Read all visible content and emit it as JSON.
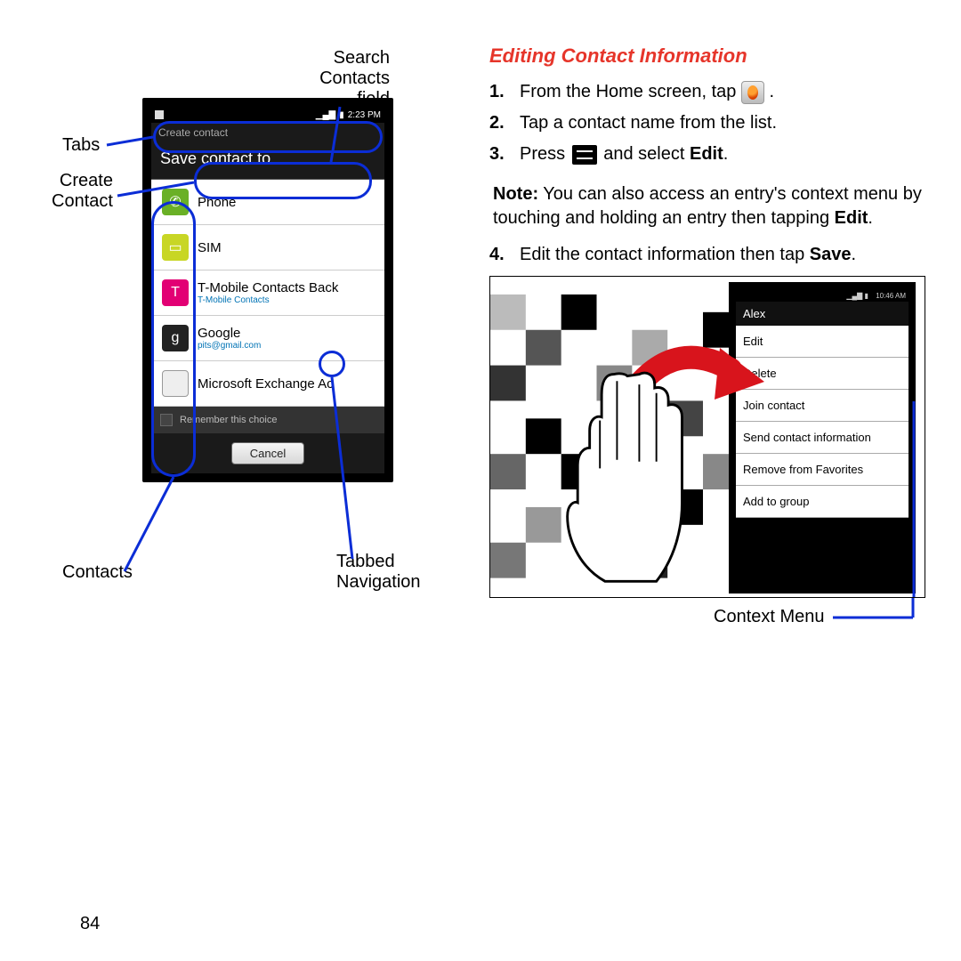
{
  "page_number": "84",
  "left_figure": {
    "callouts": {
      "search": "Search\nContacts\nfield",
      "tabs": "Tabs",
      "create": "Create\nContact",
      "contacts": "Contacts",
      "tabbed": "Tabbed\nNavigation"
    },
    "status_time": "2:23 PM",
    "create_header": "Create contact",
    "dialog_title": "Save contact to",
    "destinations": [
      {
        "title": "Phone",
        "sub": ""
      },
      {
        "title": "SIM",
        "sub": ""
      },
      {
        "title": "T-Mobile Contacts Back",
        "sub": "T-Mobile Contacts"
      },
      {
        "title": "Google",
        "sub": "pits@gmail.com"
      },
      {
        "title": "Microsoft Exchange Ac",
        "sub": ""
      }
    ],
    "remember": "Remember this choice",
    "cancel": "Cancel"
  },
  "right": {
    "title": "Editing Contact Information",
    "steps": {
      "s1a": "From the Home screen, tap ",
      "s1b": ".",
      "s2": "Tap a contact name from the list.",
      "s3a": "Press ",
      "s3b": " and select ",
      "s3c": "Edit",
      "s3d": ".",
      "note_label": "Note:",
      "note_body": " You can also access an entry's context menu by touching and holding an entry then tapping ",
      "note_bold": "Edit",
      "note_end": ".",
      "s4a": "Edit the contact information then tap ",
      "s4b": "Save",
      "s4c": "."
    },
    "fig2": {
      "status_time": "10:46 AM",
      "header": "Alex",
      "items": [
        "Edit",
        "Delete",
        "Join contact",
        "Send contact information",
        "Remove from Favorites",
        "Add to group"
      ],
      "caption": "Context Menu"
    }
  }
}
